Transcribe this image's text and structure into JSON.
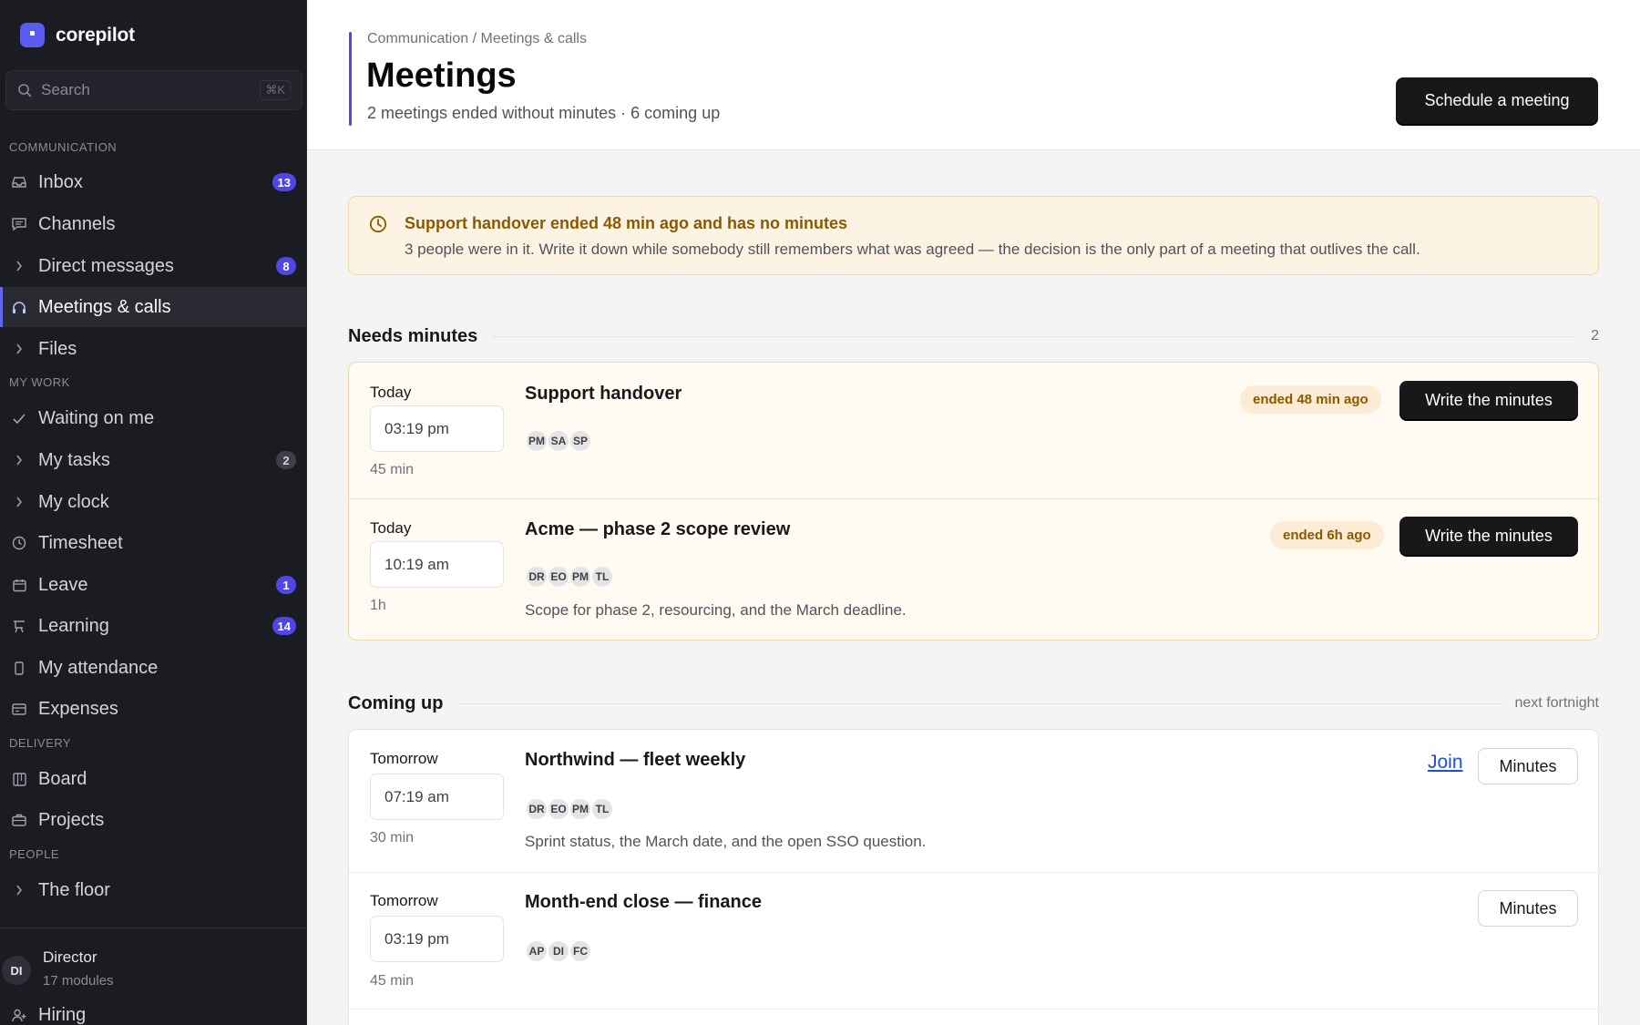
{
  "app": {
    "name": "corepilot"
  },
  "search": {
    "placeholder": "Search",
    "shortcut": "⌘K"
  },
  "sidebar": {
    "sections": {
      "communication": "COMMUNICATION",
      "my_work": "MY WORK",
      "delivery": "DELIVERY",
      "people": "PEOPLE"
    },
    "items": {
      "inbox": {
        "label": "Inbox",
        "badge": "13"
      },
      "channels": {
        "label": "Channels"
      },
      "direct_messages": {
        "label": "Direct messages",
        "badge": "8"
      },
      "meetings": {
        "label": "Meetings & calls"
      },
      "files": {
        "label": "Files"
      },
      "waiting": {
        "label": "Waiting on me"
      },
      "tasks": {
        "label": "My tasks",
        "badge": "2"
      },
      "clock": {
        "label": "My clock"
      },
      "timesheet": {
        "label": "Timesheet"
      },
      "leave": {
        "label": "Leave",
        "badge": "1"
      },
      "learning": {
        "label": "Learning",
        "badge": "14"
      },
      "attendance": {
        "label": "My attendance"
      },
      "expenses": {
        "label": "Expenses"
      },
      "board": {
        "label": "Board"
      },
      "projects": {
        "label": "Projects"
      },
      "floor": {
        "label": "The floor"
      },
      "hiring": {
        "label": "Hiring"
      }
    },
    "user": {
      "initials": "DI",
      "role": "Director",
      "sub": "17 modules"
    }
  },
  "header": {
    "breadcrumb": "Communication / Meetings & calls",
    "title": "Meetings",
    "subtitle": "2 meetings ended without minutes · 6 coming up",
    "schedule_label": "Schedule a meeting"
  },
  "alert": {
    "title": "Support handover ended 48 min ago and has no minutes",
    "body": "3 people were in it. Write it down while somebody still remembers what was agreed — the decision is the only part of a meeting that outlives the call."
  },
  "needs_minutes": {
    "title": "Needs minutes",
    "count": "2",
    "meetings": [
      {
        "day": "Today",
        "time": "03:19 pm",
        "duration": "45 min",
        "title": "Support handover",
        "attendees": [
          "PM",
          "SA",
          "SP"
        ],
        "status": "ended 48 min ago",
        "action": "Write the minutes"
      },
      {
        "day": "Today",
        "time": "10:19 am",
        "duration": "1h",
        "title": "Acme — phase 2 scope review",
        "attendees": [
          "DR",
          "EO",
          "PM",
          "TL"
        ],
        "description": "Scope for phase 2, resourcing, and the March deadline.",
        "status": "ended 6h ago",
        "action": "Write the minutes"
      }
    ]
  },
  "coming_up": {
    "title": "Coming up",
    "range": "next fortnight",
    "meetings": [
      {
        "day": "Tomorrow",
        "time": "07:19 am",
        "duration": "30 min",
        "title": "Northwind — fleet weekly",
        "attendees": [
          "DR",
          "EO",
          "PM",
          "TL"
        ],
        "description": "Sprint status, the March date, and the open SSO question.",
        "join": "Join",
        "minutes": "Minutes"
      },
      {
        "day": "Tomorrow",
        "time": "03:19 pm",
        "duration": "45 min",
        "title": "Month-end close — finance",
        "attendees": [
          "AP",
          "DI",
          "FC"
        ],
        "minutes": "Minutes"
      }
    ]
  }
}
